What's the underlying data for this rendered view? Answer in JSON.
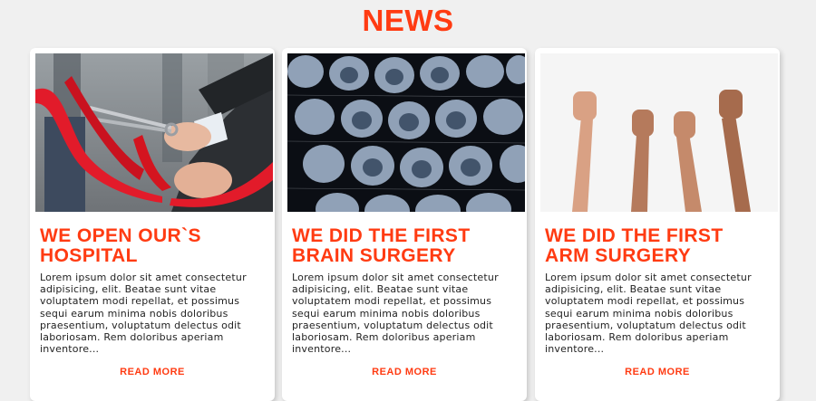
{
  "section": {
    "title": "NEWS"
  },
  "cards": [
    {
      "image": "ribbon-cutting-photo",
      "title": "WE OPEN OUR`S HOSPITAL",
      "text": "Lorem ipsum dolor sit amet consectetur adipisicing, elit. Beatae sunt vitae voluptatem modi repellat, et possimus sequi earum minima nobis doloribus praesentium, voluptatum delectus odit laboriosam. Rem doloribus aperiam inventore...",
      "link": "READ MORE"
    },
    {
      "image": "brain-mri-scans-photo",
      "title": "WE DID THE FIRST BRAIN SURGERY",
      "text": "Lorem ipsum dolor sit amet consectetur adipisicing, elit. Beatae sunt vitae voluptatem modi repellat, et possimus sequi earum minima nobis doloribus praesentium, voluptatum delectus odit laboriosam. Rem doloribus aperiam inventore...",
      "link": "READ MORE"
    },
    {
      "image": "raised-fists-photo",
      "title": "WE DID THE FIRST ARM SURGERY",
      "text": "Lorem ipsum dolor sit amet consectetur adipisicing, elit. Beatae sunt vitae voluptatem modi repellat, et possimus sequi earum minima nobis doloribus praesentium, voluptatum delectus odit laboriosam. Rem doloribus aperiam inventore...",
      "link": "READ MORE"
    }
  ],
  "colors": {
    "accent": "#ff3b12",
    "background": "#f0f0f0",
    "card": "#ffffff",
    "body_text": "#222222"
  }
}
